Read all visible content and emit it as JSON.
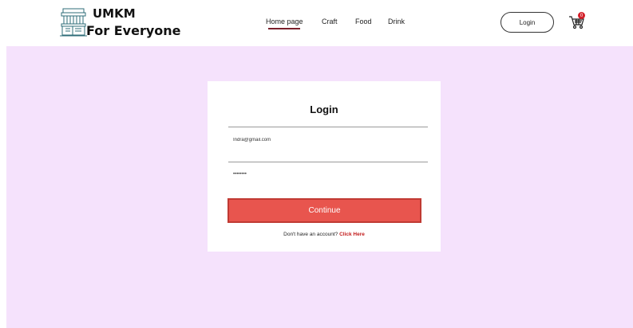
{
  "brand": {
    "line1": "UMKM",
    "line2": "For Everyone",
    "icon": "storefront-icon"
  },
  "nav": {
    "items": [
      "Home page",
      "Craft",
      "Food",
      "Drink"
    ],
    "active_index": 0
  },
  "header": {
    "login_label": "Login",
    "cart_icon": "cart-icon",
    "cart_count": "0"
  },
  "login_card": {
    "title": "Login",
    "email_value": "Indra@gmail.com",
    "password_value": "••••••••",
    "continue_label": "Continue",
    "signup_prompt": "Don't have an account?",
    "signup_link": "Click Here"
  },
  "colors": {
    "background": "#f5e2fc",
    "accent": "#e8554e",
    "link": "#c21a1a",
    "nav_underline": "#7a1f2b"
  }
}
